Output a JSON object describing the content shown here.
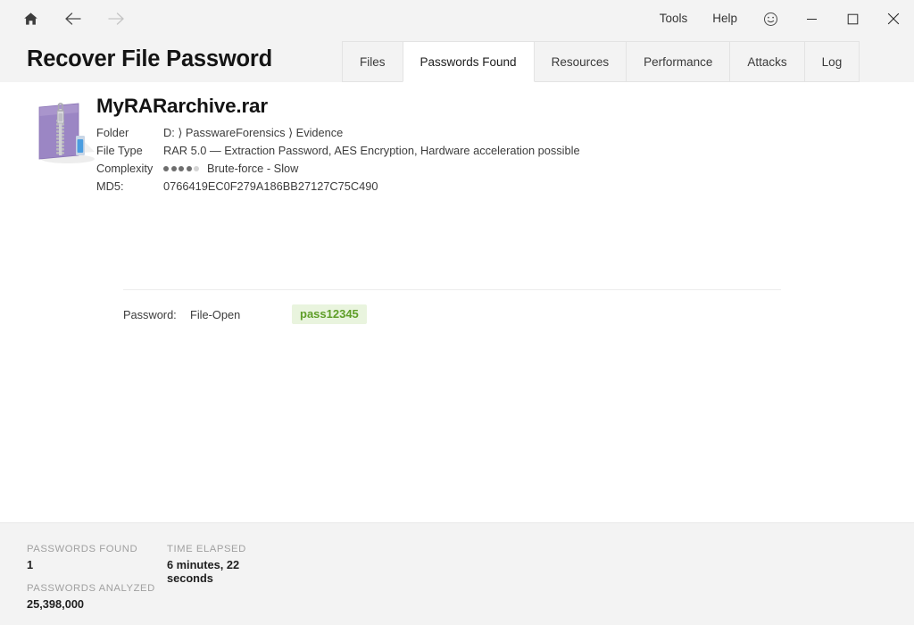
{
  "titlebar": {
    "nav": [
      {
        "name": "home-icon",
        "label": "Home"
      },
      {
        "name": "back-arrow-icon",
        "label": "Back"
      },
      {
        "name": "forward-arrow-icon",
        "label": "Forward"
      }
    ],
    "menus": [
      {
        "label": "Tools"
      },
      {
        "label": "Help"
      }
    ],
    "smiley_icon": "smiley-icon",
    "window_controls": [
      {
        "name": "minimize-button",
        "label": "Minimize"
      },
      {
        "name": "maximize-button",
        "label": "Maximize"
      },
      {
        "name": "close-button",
        "label": "Close"
      }
    ]
  },
  "header": {
    "title": "Recover File Password"
  },
  "tabs": [
    {
      "label": "Files",
      "active": false
    },
    {
      "label": "Passwords Found",
      "active": true
    },
    {
      "label": "Resources",
      "active": false
    },
    {
      "label": "Performance",
      "active": false
    },
    {
      "label": "Attacks",
      "active": false
    },
    {
      "label": "Log",
      "active": false
    }
  ],
  "file": {
    "icon": "rar-archive-icon",
    "name": "MyRARarchive.rar",
    "meta": [
      {
        "label": "Folder",
        "value": "D: ⟩ PasswareForensics ⟩ Evidence"
      },
      {
        "label": "File Type",
        "value": "RAR 5.0 — Extraction Password, AES Encryption, Hardware acceleration possible"
      },
      {
        "label": "Complexity",
        "value": "Brute-force - Slow"
      },
      {
        "label": "MD5:",
        "value": "0766419EC0F279A186BB27127C75C490"
      }
    ],
    "complexity": {
      "label": "Complexity",
      "filled": 4,
      "total": 5,
      "text": "Brute-force - Slow"
    },
    "md5_label": "MD5:",
    "md5_value": "0766419EC0F279A186BB27127C75C490",
    "folder_label": "Folder",
    "folder_value": "D: ⟩ PasswareForensics ⟩ Evidence",
    "filetype_label": "File Type",
    "filetype_value": "RAR 5.0 — Extraction Password, AES Encryption, Hardware acceleration possible"
  },
  "password": {
    "label": "Password:",
    "type": "File-Open",
    "value": "pass12345"
  },
  "status": {
    "passwords_found_label": "PASSWORDS FOUND",
    "passwords_found_value": "1",
    "passwords_analyzed_label": "PASSWORDS ANALYZED",
    "passwords_analyzed_value": "25,398,000",
    "time_elapsed_label": "TIME ELAPSED",
    "time_elapsed_value": "6 minutes, 22 seconds"
  },
  "colors": {
    "chrome": "#f3f3f3",
    "content": "#ffffff",
    "password_text": "#5f9e28",
    "password_bg": "#e9f4de",
    "folder_purple": "#9b86c4",
    "accent_blue": "#4a9de0"
  }
}
